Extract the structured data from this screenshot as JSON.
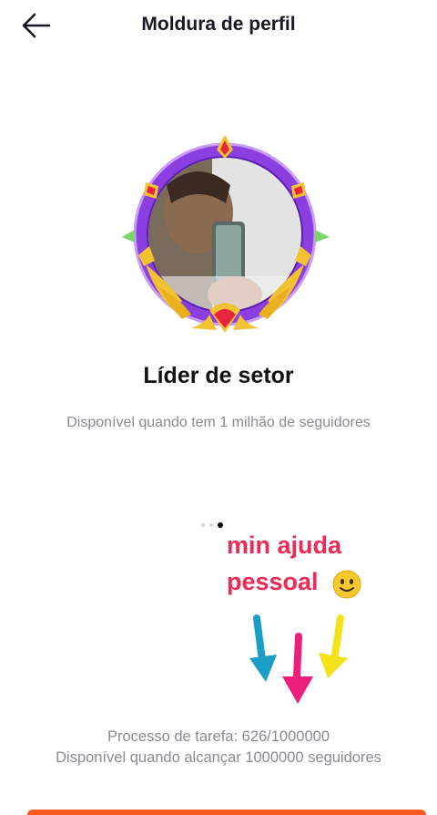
{
  "header": {
    "title": "Moldura de perfil",
    "back_icon": "arrow-left-icon"
  },
  "frame": {
    "name": "Líder de setor",
    "description": "Disponível quando tem 1 milhão de seguidores",
    "frame_colors": {
      "ring": "#8b3fe0",
      "gold": "#f2c230",
      "gem": "#e8253f"
    }
  },
  "carousel": {
    "page_count": 3,
    "active_index": 2
  },
  "overlay": {
    "line1": "min ajuda",
    "line2": "pessoal",
    "emoji_icon": "smiley-icon",
    "text_color": "#ee2a56",
    "arrow_colors": [
      "#1a9ec8",
      "#ee1f7a",
      "#f3e21a"
    ]
  },
  "task": {
    "progress": "Processo de tarefa: 626/1000000",
    "requirement": "Disponível quando alcançar 1000000 seguidores"
  },
  "action_button": {
    "color": "#f55a1e"
  }
}
